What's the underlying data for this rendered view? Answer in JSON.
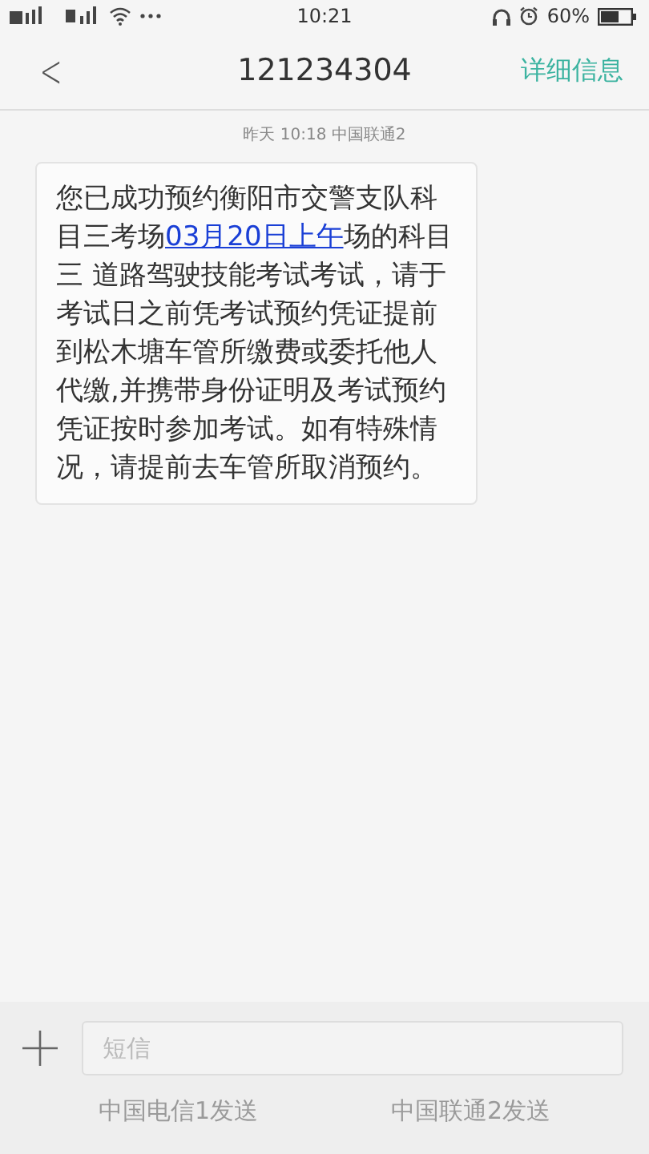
{
  "status_bar": {
    "time": "10:21",
    "battery": "60%"
  },
  "header": {
    "back": "<",
    "title": "121234304",
    "action": "详细信息"
  },
  "messages": [
    {
      "timestamp": "昨天  10:18  中国联通2",
      "text_before": "您已成功预约衡阳市交警支队科目三考场",
      "link": "03月20日上午",
      "text_after": "场的科目三 道路驾驶技能考试考试，请于考试日之前凭考试预约凭证提前到松木塘车管所缴费或委托他人代缴,并携带身份证明及考试预约凭证按时参加考试。如有特殊情况，请提前去车管所取消预约。"
    }
  ],
  "composer": {
    "placeholder": "短信",
    "send_buttons": [
      "中国电信1发送",
      "中国联通2发送"
    ]
  }
}
